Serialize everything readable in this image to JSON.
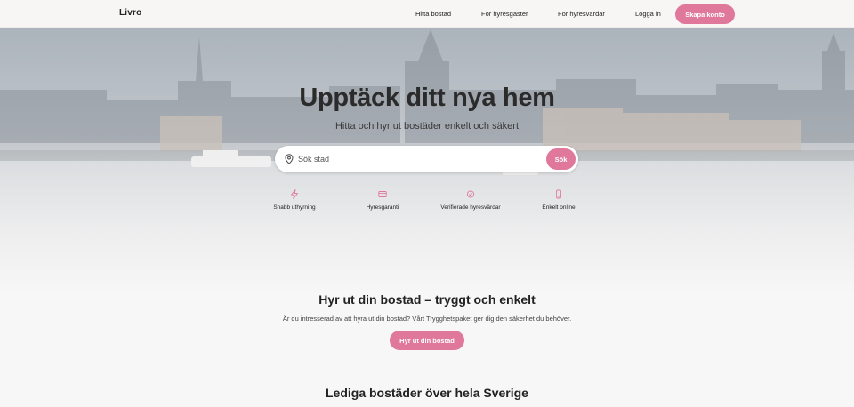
{
  "header": {
    "logo": "Livro",
    "nav": {
      "find_home": "Hitta bostad",
      "for_tenants": "För hyresgäster",
      "for_landlords": "För hyresvärdar",
      "login": "Logga in"
    },
    "create_account": "Skapa konto"
  },
  "hero": {
    "title": "Upptäck ditt nya hem",
    "subtitle": "Hitta och hyr ut bostäder enkelt och säkert",
    "search": {
      "placeholder": "Sök stad",
      "value": "",
      "button": "Sök"
    },
    "features": [
      {
        "icon": "lightning-icon",
        "label": "Snabb uthyrning"
      },
      {
        "icon": "credit-card-icon",
        "label": "Hyresgaranti"
      },
      {
        "icon": "verified-badge-icon",
        "label": "Verifierade hyresvärdar"
      },
      {
        "icon": "smartphone-icon",
        "label": "Enkelt online"
      }
    ]
  },
  "rent_section": {
    "title": "Hyr ut din bostad – tryggt och enkelt",
    "text": "Är du intresserad av att hyra ut din bostad? Vårt Trygghetspaket ger dig den säkerhet du behöver.",
    "button": "Hyr ut din bostad"
  },
  "listings_section": {
    "title": "Lediga bostäder över hela Sverige"
  },
  "colors": {
    "accent": "#e0789b",
    "background": "#f8f7f7",
    "text": "#222222"
  }
}
